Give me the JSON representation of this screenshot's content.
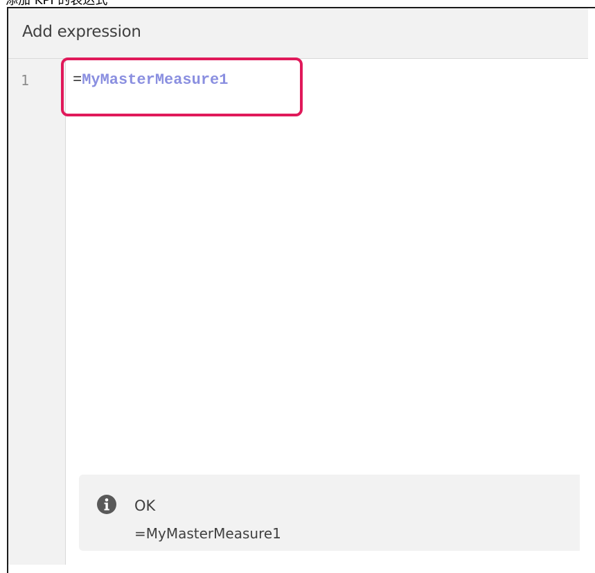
{
  "caption": "添加 KPI 的表达式",
  "dialog": {
    "title": "Add expression"
  },
  "editor": {
    "line_numbers": [
      "1"
    ],
    "lines": [
      {
        "operator": "=",
        "reference": "MyMasterMeasure1"
      }
    ],
    "highlight_color": "#e0195a",
    "reference_color": "#8a8fe0"
  },
  "status": {
    "icon": "info-icon",
    "title": "OK",
    "expression": "=MyMasterMeasure1"
  }
}
